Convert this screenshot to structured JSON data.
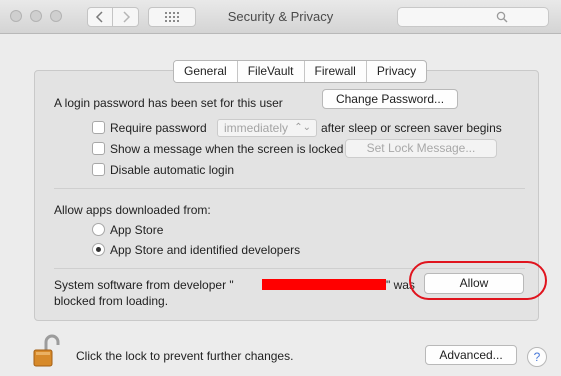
{
  "window": {
    "title": "Security & Privacy"
  },
  "tabs": [
    "General",
    "FileVault",
    "Firewall",
    "Privacy"
  ],
  "login": {
    "message": "A login password has been set for this user",
    "change_password_button": "Change Password...",
    "require_password_label": "Require password",
    "require_password_value": "immediately",
    "after_sleep_label": "after sleep or screen saver begins",
    "show_message_label": "Show a message when the screen is locked",
    "set_lock_message_button": "Set Lock Message...",
    "disable_auto_login_label": "Disable automatic login"
  },
  "downloads": {
    "heading": "Allow apps downloaded from:",
    "options": [
      "App Store",
      "App Store and identified developers"
    ],
    "selected_index": 1
  },
  "blocked": {
    "line1_prefix": "System software from developer \"",
    "line1_suffix": "\" was",
    "line2": "blocked from loading.",
    "allow_button": "Allow"
  },
  "footer": {
    "lock_text": "Click the lock to prevent further changes.",
    "advanced_button": "Advanced...",
    "help_button": "?"
  },
  "colors": {
    "redaction": "#ff0000",
    "highlight_ring": "#e0141e",
    "help_accent": "#4878d8"
  }
}
